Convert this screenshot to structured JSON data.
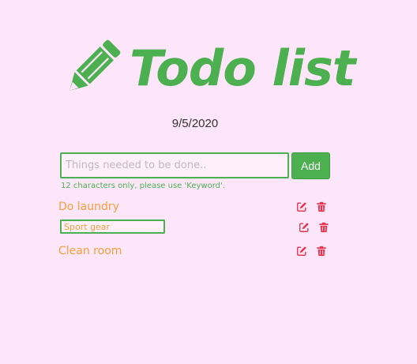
{
  "header": {
    "title": "Todo list"
  },
  "date": "9/5/2020",
  "new_task": {
    "value": "",
    "placeholder": "Things needed to be done.."
  },
  "add_button_label": "Add",
  "hint": "12 characters only, please use 'Keyword'.",
  "todos": [
    {
      "text": "Do laundry",
      "editing": false
    },
    {
      "text": "Sport gear",
      "editing": true
    },
    {
      "text": "Clean room",
      "editing": false
    }
  ],
  "icons": {
    "title": "pencil-icon",
    "edit": "edit-icon",
    "delete": "trash-icon"
  },
  "colors": {
    "background": "#fde6fa",
    "accent": "#4caf50",
    "todo_text": "#f5a03c",
    "action_icons": "#e8344d"
  }
}
